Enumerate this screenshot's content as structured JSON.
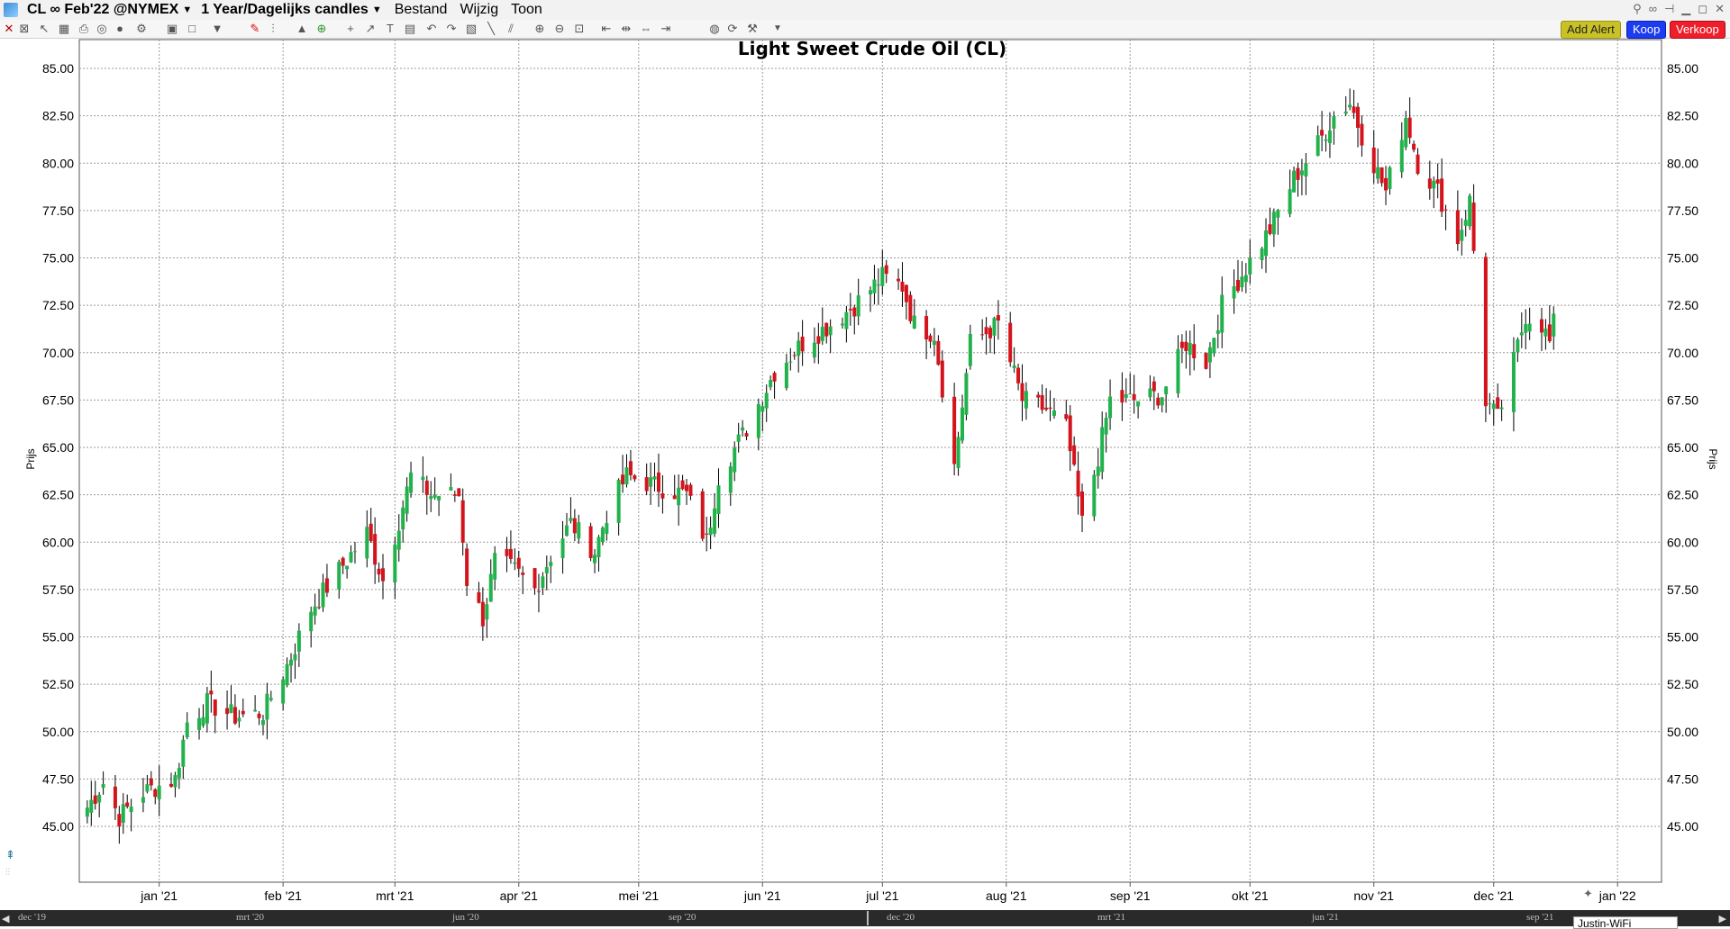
{
  "menubar": {
    "symbol": "CL ∞ Feb'22 @NYMEX",
    "timeframe": "1 Year/Dagelijks candles",
    "menus": [
      "Bestand",
      "Wijzig",
      "Toon"
    ]
  },
  "toolbar": {
    "add_alert": "Add Alert",
    "buy": "Koop",
    "sell": "Verkoop"
  },
  "chart_data": {
    "type": "candlestick",
    "title": "Light Sweet Crude Oil (CL)",
    "ylabel": "Prijs",
    "ylim": [
      42.5,
      85.5
    ],
    "y_ticks": [
      "85.00",
      "82.50",
      "80.00",
      "77.50",
      "75.00",
      "72.50",
      "70.00",
      "67.50",
      "65.00",
      "62.50",
      "60.00",
      "57.50",
      "55.00",
      "52.50",
      "50.00",
      "47.50",
      "45.00"
    ],
    "x_ticks": [
      "jan '21",
      "feb '21",
      "mrt '21",
      "apr '21",
      "mei '21",
      "jun '21",
      "jul '21",
      "aug '21",
      "sep '21",
      "okt '21",
      "nov '21",
      "dec '21",
      "jan '22"
    ],
    "up_color": "#22b24c",
    "down_color": "#d4141c",
    "grid": true,
    "anchors": [
      [
        "2020-12-14",
        46.0
      ],
      [
        "2020-12-18",
        47.3
      ],
      [
        "2020-12-22",
        45.5
      ],
      [
        "2020-12-28",
        46.8
      ],
      [
        "2021-01-05",
        47.5
      ],
      [
        "2021-01-08",
        50.5
      ],
      [
        "2021-01-13",
        51.5
      ],
      [
        "2021-01-20",
        50.8
      ],
      [
        "2021-01-27",
        51.0
      ],
      [
        "2021-02-02",
        53.5
      ],
      [
        "2021-02-08",
        56.5
      ],
      [
        "2021-02-15",
        58.5
      ],
      [
        "2021-02-22",
        60.5
      ],
      [
        "2021-02-26",
        58.0
      ],
      [
        "2021-03-05",
        63.5
      ],
      [
        "2021-03-10",
        62.5
      ],
      [
        "2021-03-17",
        62.5
      ],
      [
        "2021-03-19",
        58.0
      ],
      [
        "2021-03-23",
        56.0
      ],
      [
        "2021-03-26",
        59.0
      ],
      [
        "2021-03-31",
        58.5
      ],
      [
        "2021-04-05",
        57.5
      ],
      [
        "2021-04-09",
        59.3
      ],
      [
        "2021-04-14",
        61.0
      ],
      [
        "2021-04-20",
        59.5
      ],
      [
        "2021-04-23",
        61.5
      ],
      [
        "2021-04-28",
        63.5
      ],
      [
        "2021-05-05",
        63.0
      ],
      [
        "2021-05-13",
        62.5
      ],
      [
        "2021-05-18",
        60.0
      ],
      [
        "2021-05-21",
        63.5
      ],
      [
        "2021-05-28",
        66.0
      ],
      [
        "2021-06-04",
        69.0
      ],
      [
        "2021-06-11",
        70.5
      ],
      [
        "2021-06-18",
        71.5
      ],
      [
        "2021-06-24",
        72.5
      ],
      [
        "2021-07-01",
        74.0
      ],
      [
        "2021-07-06",
        73.5
      ],
      [
        "2021-07-09",
        71.5
      ],
      [
        "2021-07-14",
        71.0
      ],
      [
        "2021-07-19",
        64.0
      ],
      [
        "2021-07-23",
        70.5
      ],
      [
        "2021-07-30",
        71.5
      ],
      [
        "2021-08-05",
        67.5
      ],
      [
        "2021-08-11",
        67.0
      ],
      [
        "2021-08-16",
        66.0
      ],
      [
        "2021-08-20",
        61.0
      ],
      [
        "2021-08-24",
        64.5
      ],
      [
        "2021-08-27",
        67.5
      ],
      [
        "2021-09-03",
        67.5
      ],
      [
        "2021-09-09",
        67.8
      ],
      [
        "2021-09-15",
        70.5
      ],
      [
        "2021-09-20",
        69.5
      ],
      [
        "2021-09-24",
        72.5
      ],
      [
        "2021-10-01",
        74.8
      ],
      [
        "2021-10-06",
        76.5
      ],
      [
        "2021-10-12",
        79.2
      ],
      [
        "2021-10-18",
        81.0
      ],
      [
        "2021-10-22",
        82.5
      ],
      [
        "2021-10-26",
        83.2
      ],
      [
        "2021-10-29",
        81.5
      ],
      [
        "2021-11-04",
        78.5
      ],
      [
        "2021-11-09",
        82.5
      ],
      [
        "2021-11-12",
        80.0
      ],
      [
        "2021-11-17",
        78.5
      ],
      [
        "2021-11-22",
        76.0
      ],
      [
        "2021-11-25",
        78.0
      ],
      [
        "2021-11-29",
        67.5
      ],
      [
        "2021-12-02",
        66.5
      ],
      [
        "2021-12-06",
        69.5
      ],
      [
        "2021-12-09",
        72.0
      ],
      [
        "2021-12-13",
        71.5
      ],
      [
        "2021-12-15",
        70.5
      ],
      [
        "2021-12-16",
        71.5
      ]
    ]
  },
  "overview": {
    "labels": [
      "dec '19",
      "mrt '20",
      "jun '20",
      "sep '20",
      "dec '20",
      "mrt '21",
      "jun '21",
      "sep '21"
    ]
  },
  "popup": {
    "text": "Justin-WiFi"
  }
}
